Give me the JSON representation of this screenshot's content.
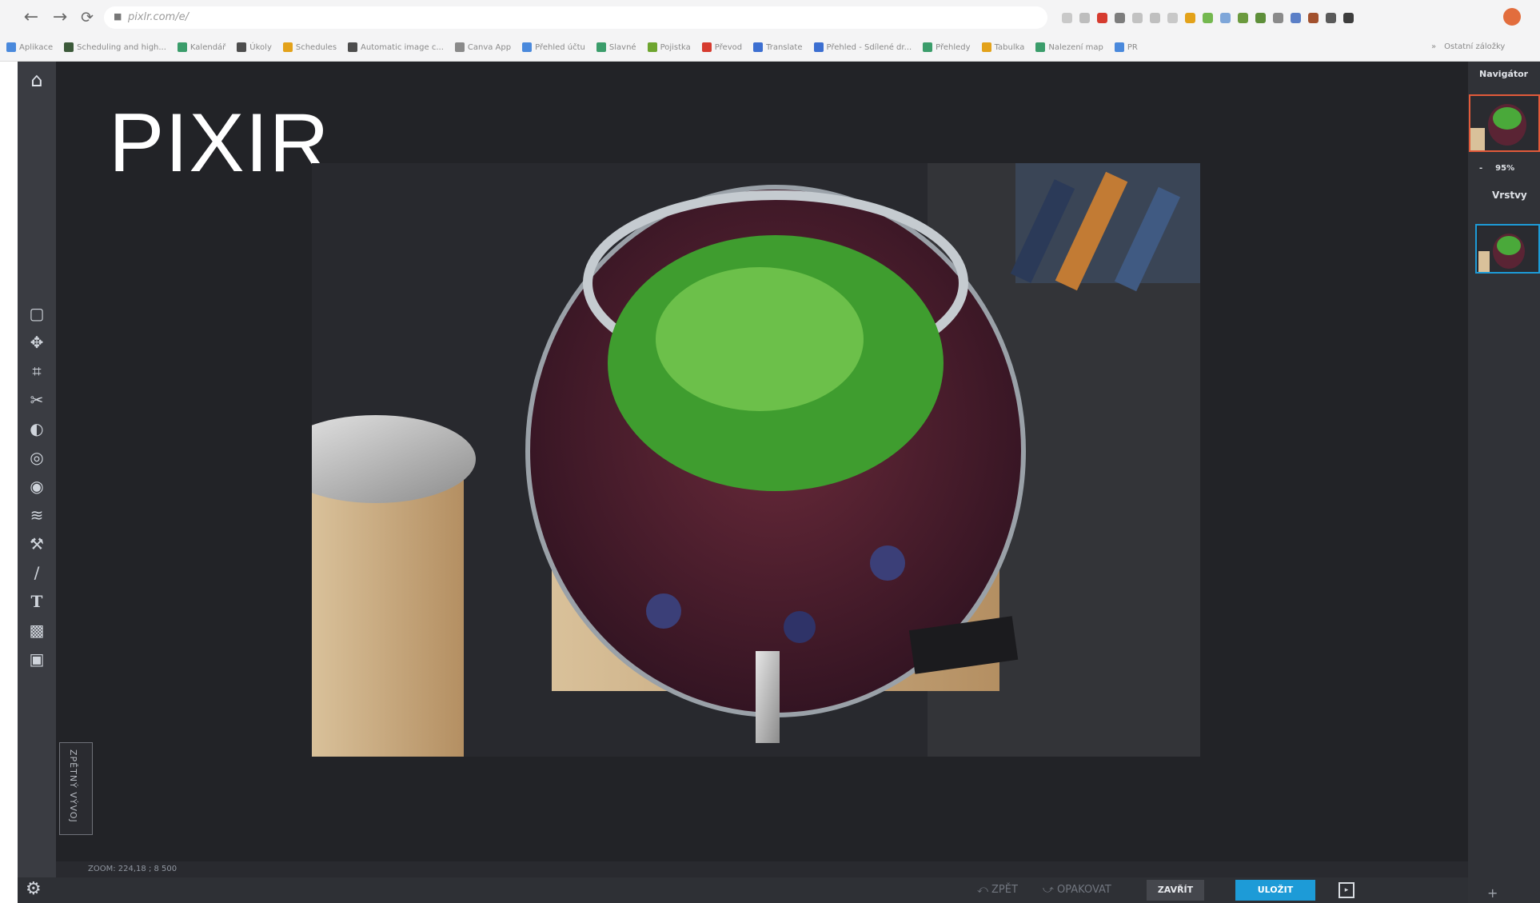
{
  "browser": {
    "url": "pixlr.com/e/",
    "bookmarks": [
      "Aplikace",
      "Scheduling and high...",
      "Kalendář",
      "Úkoly",
      "Schedules",
      "Automatic image c...",
      "Canva App",
      "Přehled účtu",
      "Slavné",
      "Pojistka",
      "Převod",
      "Translate",
      "Přehled - Sdílené dr...",
      "Přehledy",
      "Tabulka",
      "Nalezení map",
      "PR"
    ],
    "other_bookmarks": "Ostatní záložky",
    "extension_colors": [
      "#c9c9c9",
      "#bdbdbd",
      "#d63b2f",
      "#7d7d7d",
      "#c2c2c2",
      "#bfbfbf",
      "#c8c8c8",
      "#e3a21a",
      "#74b84f",
      "#7ea6d9",
      "#6b9a3e",
      "#5e8f3a",
      "#8a8a8a",
      "#5b7fc7",
      "#a2512e",
      "#5a5a5a",
      "#3d3d3d"
    ],
    "profile_color": "#e26d3d"
  },
  "app": {
    "brand": "PIXIR",
    "home_icon": "home-icon",
    "tools": [
      "arrange-icon",
      "move-icon",
      "crop-icon",
      "cutout-icon",
      "adjust-icon",
      "filter-icon",
      "liquify-icon",
      "pattern-icon",
      "retouch-icon",
      "draw-icon",
      "text-icon",
      "element-icon",
      "image-icon"
    ],
    "history_tab": "ZPĚTNÝ VÝVOJ",
    "status": "ZOOM: 224,18 ; 8 500",
    "undo_label": "⤺ ZPĚT",
    "redo_label": "⤻ OPAKOVAT",
    "close_label": "ZAVŘÍT",
    "save_label": "ULOŽIT",
    "navigator_title": "Navigátor",
    "zoom_value": "95%",
    "zoom_minus": "-",
    "zoom_plus": "+",
    "layers_title": "Vrstvy",
    "layer_tools": "+",
    "accent_color": "#1d9bd7"
  }
}
